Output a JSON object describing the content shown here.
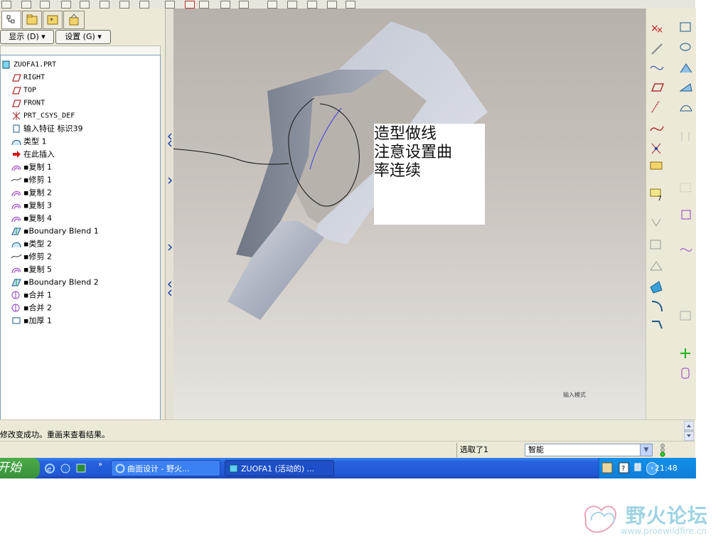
{
  "left_panel": {
    "show_menu_label": "显示 (D) ▾",
    "settings_menu_label": "设置 (G) ▾",
    "tree_items": [
      {
        "label": "ZUOFA1.PRT",
        "icon": "part-icon"
      },
      {
        "label": "RIGHT",
        "icon": "datum-plane-icon"
      },
      {
        "label": "TOP",
        "icon": "datum-plane-icon"
      },
      {
        "label": "FRONT",
        "icon": "datum-plane-icon"
      },
      {
        "label": "PRT_CSYS_DEF",
        "icon": "csys-icon"
      },
      {
        "label": "输入特征 标识39",
        "icon": "import-feature-icon"
      },
      {
        "label": "类型 1",
        "icon": "style-icon"
      },
      {
        "label": "在此插入",
        "icon": "insert-here-icon"
      },
      {
        "label": "▪复制 1",
        "icon": "copy-surface-icon"
      },
      {
        "label": "▪修剪 1",
        "icon": "trim-icon"
      },
      {
        "label": "▪复制 2",
        "icon": "copy-surface-icon"
      },
      {
        "label": "▪复制 3",
        "icon": "copy-surface-icon"
      },
      {
        "label": "▪复制 4",
        "icon": "copy-surface-icon"
      },
      {
        "label": "▪Boundary Blend 1",
        "icon": "boundary-blend-icon"
      },
      {
        "label": "▪类型 2",
        "icon": "style-icon"
      },
      {
        "label": "▪修剪 2",
        "icon": "trim-icon"
      },
      {
        "label": "▪复制 5",
        "icon": "copy-surface-icon"
      },
      {
        "label": "▪Boundary Blend 2",
        "icon": "boundary-blend-icon"
      },
      {
        "label": "▪合并 1",
        "icon": "merge-icon"
      },
      {
        "label": "▪合并 2",
        "icon": "merge-icon"
      },
      {
        "label": "▪加厚 1",
        "icon": "thicken-icon"
      }
    ]
  },
  "viewport": {
    "note_lines": [
      "造型做线",
      "注意设置曲",
      "率连续"
    ],
    "mode_label": "输入模式"
  },
  "message_area": {
    "text": "修改变成功。重画来查看结果。"
  },
  "status_bar": {
    "selection_count": "选取了1",
    "filter_value": "智能"
  },
  "taskbar": {
    "start_label": "开始",
    "task_1": "曲面设计 - 野火...",
    "task_2": "ZUOFA1 (活动的) ...",
    "clock": "21:48"
  },
  "watermark": {
    "title": "野火论坛",
    "url": "www.proewildfire.cn"
  },
  "colors": {
    "panel_bg": "#ece9d8",
    "taskbar_blue": "#2057d4",
    "start_green": "#3a9a3a",
    "surface_gray": "#a2a8b6"
  }
}
